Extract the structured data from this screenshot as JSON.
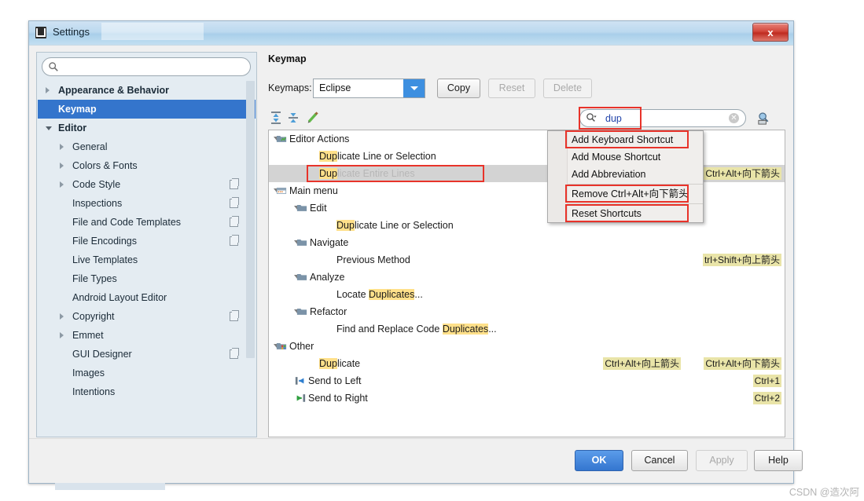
{
  "window": {
    "title": "Settings",
    "close_label": "x"
  },
  "sidebar": {
    "search_placeholder": "",
    "items": [
      {
        "label": "Appearance & Behavior",
        "indent": 26,
        "arrow": "right",
        "bold": true,
        "selected": false,
        "copy": false
      },
      {
        "label": "Keymap",
        "indent": 26,
        "arrow": "none",
        "bold": true,
        "selected": true,
        "copy": false
      },
      {
        "label": "Editor",
        "indent": 26,
        "arrow": "down",
        "bold": true,
        "selected": false,
        "copy": false
      },
      {
        "label": "General",
        "indent": 44,
        "arrow": "right",
        "bold": false,
        "selected": false,
        "copy": false
      },
      {
        "label": "Colors & Fonts",
        "indent": 44,
        "arrow": "right",
        "bold": false,
        "selected": false,
        "copy": false
      },
      {
        "label": "Code Style",
        "indent": 44,
        "arrow": "right",
        "bold": false,
        "selected": false,
        "copy": true
      },
      {
        "label": "Inspections",
        "indent": 44,
        "arrow": "none",
        "bold": false,
        "selected": false,
        "copy": true
      },
      {
        "label": "File and Code Templates",
        "indent": 44,
        "arrow": "none",
        "bold": false,
        "selected": false,
        "copy": true
      },
      {
        "label": "File Encodings",
        "indent": 44,
        "arrow": "none",
        "bold": false,
        "selected": false,
        "copy": true
      },
      {
        "label": "Live Templates",
        "indent": 44,
        "arrow": "none",
        "bold": false,
        "selected": false,
        "copy": false
      },
      {
        "label": "File Types",
        "indent": 44,
        "arrow": "none",
        "bold": false,
        "selected": false,
        "copy": false
      },
      {
        "label": "Android Layout Editor",
        "indent": 44,
        "arrow": "none",
        "bold": false,
        "selected": false,
        "copy": false
      },
      {
        "label": "Copyright",
        "indent": 44,
        "arrow": "right",
        "bold": false,
        "selected": false,
        "copy": true
      },
      {
        "label": "Emmet",
        "indent": 44,
        "arrow": "right",
        "bold": false,
        "selected": false,
        "copy": false
      },
      {
        "label": "GUI Designer",
        "indent": 44,
        "arrow": "none",
        "bold": false,
        "selected": false,
        "copy": true
      },
      {
        "label": "Images",
        "indent": 44,
        "arrow": "none",
        "bold": false,
        "selected": false,
        "copy": false
      },
      {
        "label": "Intentions",
        "indent": 44,
        "arrow": "none",
        "bold": false,
        "selected": false,
        "copy": false
      }
    ]
  },
  "main": {
    "pane_title": "Keymap",
    "keymaps_label": "Keymaps:",
    "keymap_value": "Eclipse",
    "buttons": {
      "copy": "Copy",
      "reset": "Reset",
      "delete": "Delete"
    },
    "filter": {
      "value": "dup",
      "placeholder": ""
    },
    "tree": [
      {
        "label": "Editor Actions",
        "indent": 26,
        "arrow": "down",
        "icon": "editor-actions-icon",
        "hl": "",
        "shortcut": "",
        "selected": false
      },
      {
        "label": "Duplicate Line or Selection",
        "indent": 64,
        "arrow": "none",
        "icon": "",
        "hl": "Dup",
        "shortcut": "",
        "selected": false
      },
      {
        "label": "Duplicate Entire Lines",
        "indent": 64,
        "arrow": "none",
        "icon": "",
        "hl": "Dup",
        "shortcut": "Ctrl+Alt+向下箭头",
        "selected": true
      },
      {
        "label": "Main menu",
        "indent": 26,
        "arrow": "down",
        "icon": "main-menu-icon",
        "hl": "",
        "shortcut": "",
        "selected": false
      },
      {
        "label": "Edit",
        "indent": 52,
        "arrow": "down",
        "icon": "folder-icon",
        "hl": "",
        "shortcut": "",
        "selected": false
      },
      {
        "label": "Duplicate Line or Selection",
        "indent": 86,
        "arrow": "none",
        "icon": "",
        "hl": "Dup",
        "shortcut": "",
        "selected": false
      },
      {
        "label": "Navigate",
        "indent": 52,
        "arrow": "down",
        "icon": "folder-icon",
        "hl": "",
        "shortcut": "",
        "selected": false
      },
      {
        "label": "Previous Method",
        "indent": 86,
        "arrow": "none",
        "icon": "",
        "hl": "",
        "shortcut": "trl+Shift+向上箭头",
        "selected": false
      },
      {
        "label": "Analyze",
        "indent": 52,
        "arrow": "down",
        "icon": "folder-icon",
        "hl": "",
        "shortcut": "",
        "selected": false
      },
      {
        "label": "Locate Duplicates...",
        "indent": 86,
        "arrow": "none",
        "icon": "",
        "hl": "Duplicates",
        "shortcut": "",
        "selected": false
      },
      {
        "label": "Refactor",
        "indent": 52,
        "arrow": "down",
        "icon": "folder-icon",
        "hl": "",
        "shortcut": "",
        "selected": false
      },
      {
        "label": "Find and Replace Code Duplicates...",
        "indent": 86,
        "arrow": "none",
        "icon": "",
        "hl": "Duplicates",
        "shortcut": "",
        "selected": false
      },
      {
        "label": "Other",
        "indent": 26,
        "arrow": "down",
        "icon": "other-icon",
        "hl": "",
        "shortcut": "",
        "selected": false
      },
      {
        "label": "Duplicate",
        "indent": 64,
        "arrow": "none",
        "icon": "",
        "hl": "Dup",
        "shortcut": "Ctrl+Alt+向下箭头",
        "shortcut2": "Ctrl+Alt+向上箭头",
        "selected": false
      },
      {
        "label": "Send to Left",
        "indent": 50,
        "arrow": "none",
        "icon": "send-left-icon",
        "hl": "",
        "shortcut": "Ctrl+1",
        "selected": false
      },
      {
        "label": "Send to Right",
        "indent": 50,
        "arrow": "none",
        "icon": "send-right-icon",
        "hl": "",
        "shortcut": "Ctrl+2",
        "selected": false
      }
    ]
  },
  "context_menu": {
    "items": [
      {
        "label": "Add Keyboard Shortcut",
        "boxed": true
      },
      {
        "label": "Add Mouse Shortcut",
        "boxed": false
      },
      {
        "label": "Add Abbreviation",
        "boxed": false
      },
      {
        "label": "Remove Ctrl+Alt+向下箭头",
        "boxed": true,
        "sep_before": true
      },
      {
        "label": "Reset Shortcuts",
        "boxed": true,
        "sep_before": true
      }
    ]
  },
  "footer": {
    "ok": "OK",
    "cancel": "Cancel",
    "apply": "Apply",
    "help": "Help"
  },
  "watermark": "CSDN @造次阿",
  "colors": {
    "selection_blue": "#3475cc",
    "highlight_yellow": "#ffe08a",
    "shortcut_bg": "#e9e4a8",
    "annotation_red": "#e8332a"
  }
}
